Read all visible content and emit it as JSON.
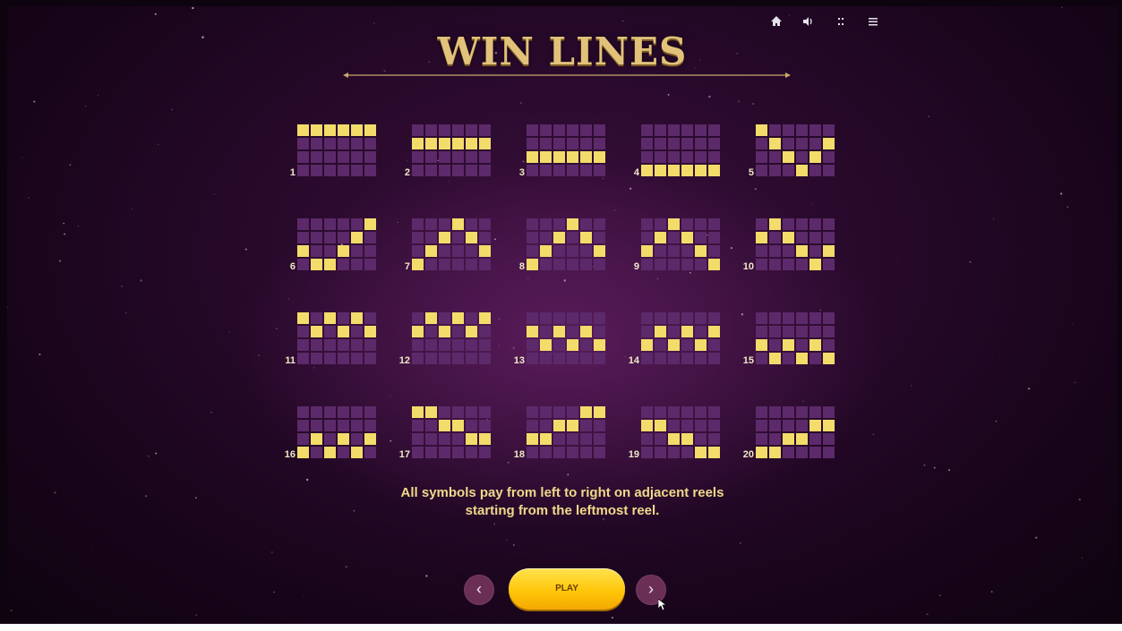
{
  "title": "WIN LINES",
  "topbar": {
    "icons": [
      "home-icon",
      "sound-icon",
      "fullscreen-icon",
      "menu-icon"
    ]
  },
  "info": {
    "line1": "All symbols pay from left to right on adjacent reels",
    "line2": "starting from the leftmost reel."
  },
  "buttons": {
    "prev": "‹",
    "play": "PLAY",
    "next": "›"
  },
  "footer_text": "",
  "colors": {
    "cell_empty": "#5c2a6a",
    "cell_active": "#f3dc6a",
    "title_gold": "#e2c27a",
    "play_yellow": "#ffc60a"
  },
  "lines": [
    {
      "n": "1",
      "rows": [
        0,
        0,
        0,
        0,
        0,
        0
      ]
    },
    {
      "n": "2",
      "rows": [
        1,
        1,
        1,
        1,
        1,
        1
      ]
    },
    {
      "n": "3",
      "rows": [
        2,
        2,
        2,
        2,
        2,
        2
      ]
    },
    {
      "n": "4",
      "rows": [
        3,
        3,
        3,
        3,
        3,
        3
      ]
    },
    {
      "n": "5",
      "rows": [
        0,
        1,
        2,
        3,
        2,
        1
      ]
    },
    {
      "n": "6",
      "rows": [
        2,
        3,
        3,
        2,
        1,
        0
      ]
    },
    {
      "n": "7",
      "rows": [
        3,
        2,
        1,
        0,
        1,
        2
      ]
    },
    {
      "n": "8",
      "rows": [
        3,
        2,
        1,
        0,
        1,
        2
      ]
    },
    {
      "n": "9",
      "rows": [
        2,
        1,
        0,
        1,
        2,
        3
      ]
    },
    {
      "n": "10",
      "rows": [
        1,
        0,
        1,
        2,
        3,
        2
      ]
    },
    {
      "n": "11",
      "rows": [
        0,
        1,
        0,
        1,
        0,
        1
      ]
    },
    {
      "n": "12",
      "rows": [
        1,
        0,
        1,
        0,
        1,
        0
      ]
    },
    {
      "n": "13",
      "rows": [
        1,
        2,
        1,
        2,
        1,
        2
      ]
    },
    {
      "n": "14",
      "rows": [
        2,
        1,
        2,
        1,
        2,
        1
      ]
    },
    {
      "n": "15",
      "rows": [
        2,
        3,
        2,
        3,
        2,
        3
      ]
    },
    {
      "n": "16",
      "rows": [
        3,
        2,
        3,
        2,
        3,
        2
      ]
    },
    {
      "n": "17",
      "rows": [
        0,
        0,
        1,
        1,
        2,
        2
      ]
    },
    {
      "n": "18",
      "rows": [
        2,
        2,
        1,
        1,
        0,
        0
      ]
    },
    {
      "n": "19",
      "rows": [
        1,
        1,
        2,
        2,
        3,
        3
      ]
    },
    {
      "n": "20",
      "rows": [
        3,
        3,
        2,
        2,
        1,
        1
      ]
    }
  ]
}
